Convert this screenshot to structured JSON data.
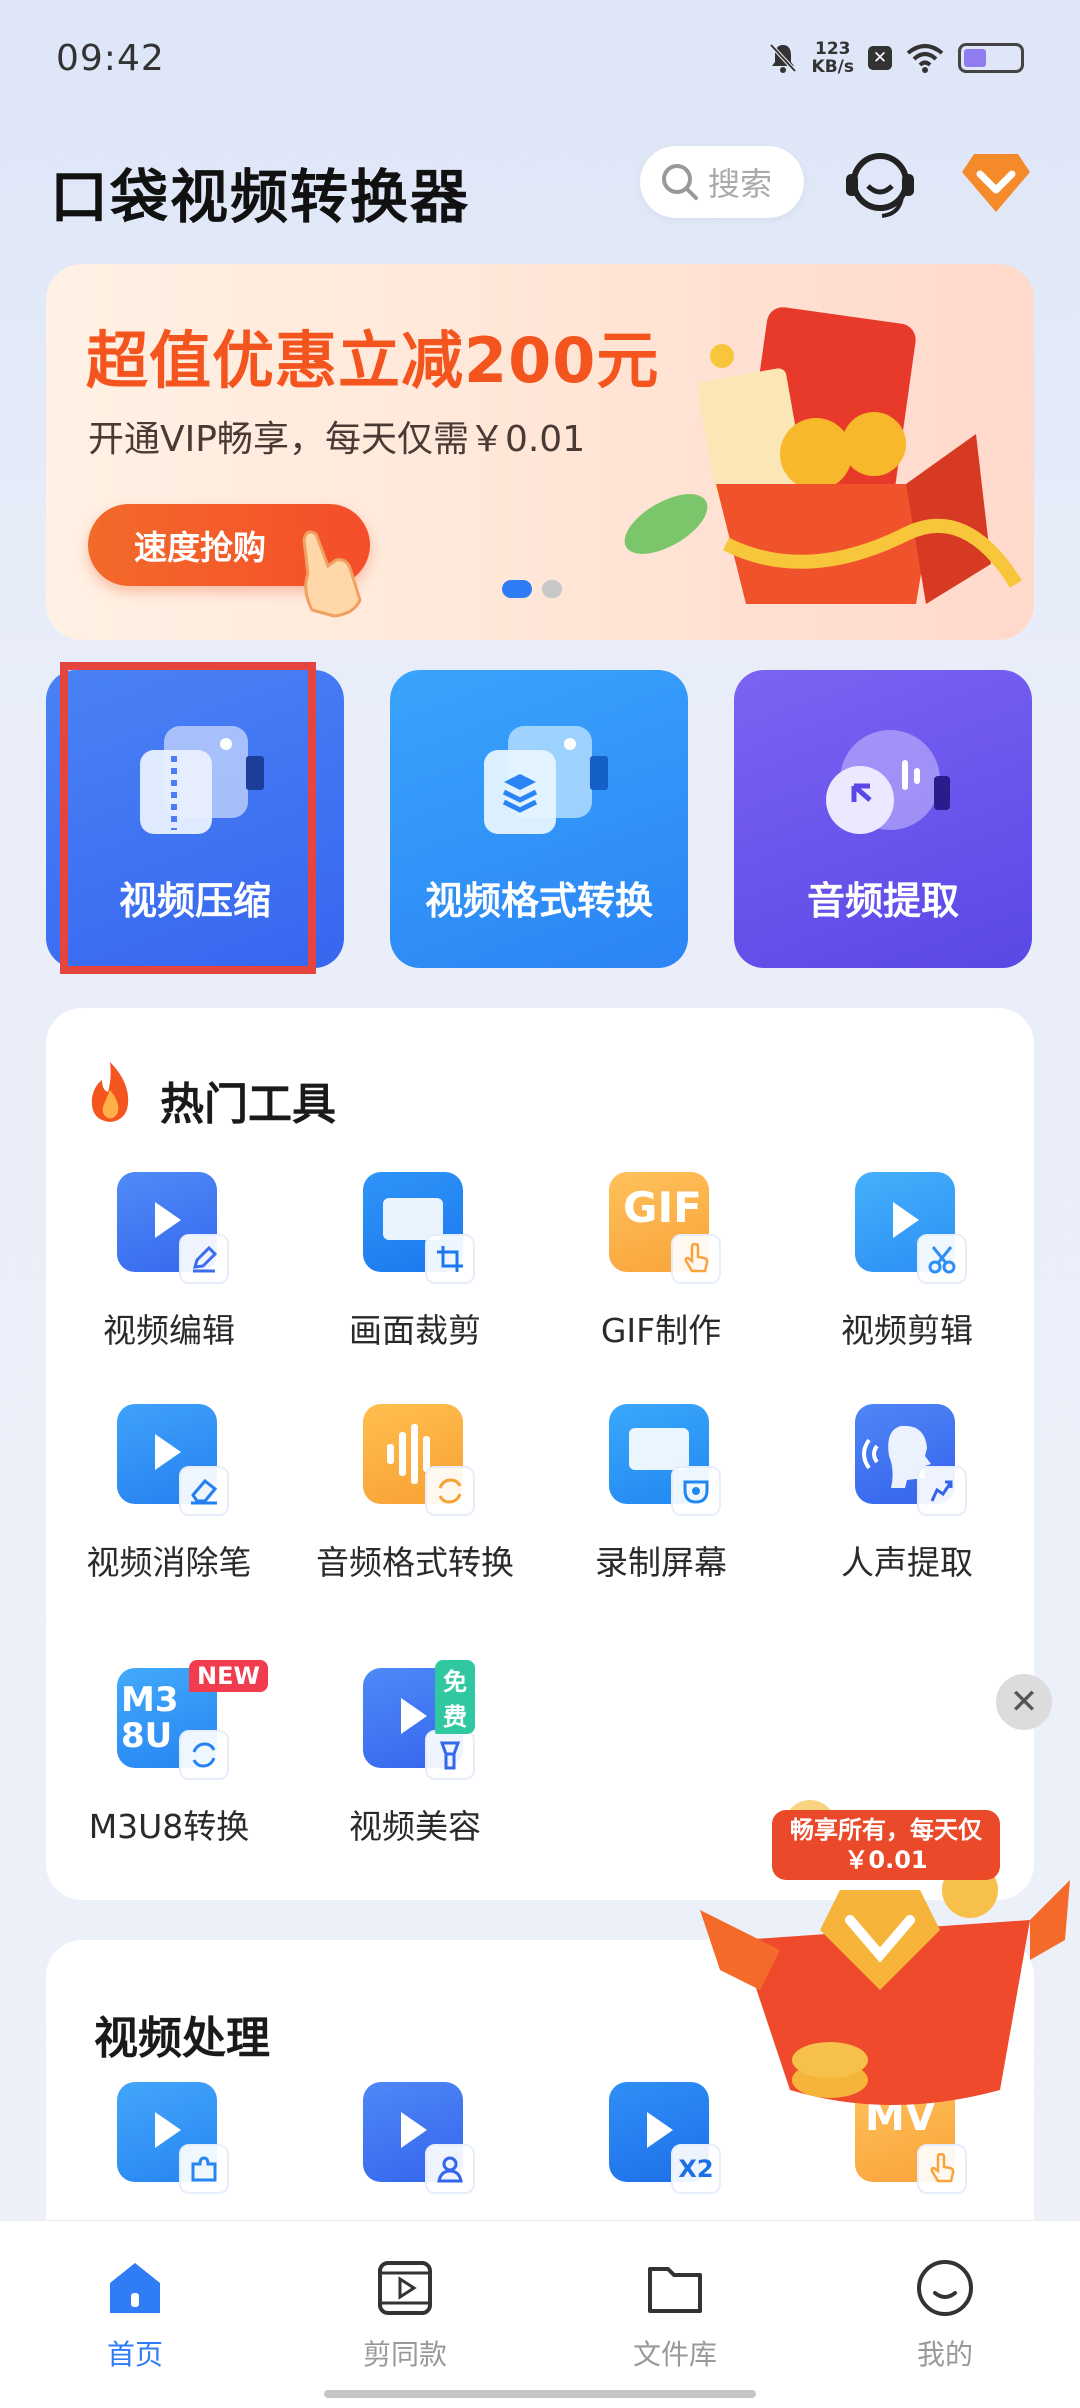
{
  "status_bar": {
    "time": "09:42",
    "net_speed_value": "123",
    "net_speed_unit": "KB/s",
    "battery_level": 0.4
  },
  "header": {
    "title": "口袋视频转换器",
    "search_placeholder": "搜索"
  },
  "banner": {
    "headline": "超值优惠立减200元",
    "subtitle": "开通VIP畅享，每天仅需￥0.01",
    "button": "速度抢购",
    "page_index": 0,
    "page_count": 2
  },
  "features": [
    {
      "label": "视频压缩"
    },
    {
      "label": "视频格式转换"
    },
    {
      "label": "音频提取"
    }
  ],
  "hot_tools": {
    "title": "热门工具",
    "items": [
      {
        "label": "视频编辑"
      },
      {
        "label": "画面裁剪"
      },
      {
        "label": "GIF制作",
        "tile_text": "GIF"
      },
      {
        "label": "视频剪辑"
      },
      {
        "label": "视频消除笔"
      },
      {
        "label": "音频格式转换"
      },
      {
        "label": "录制屏幕"
      },
      {
        "label": "人声提取"
      },
      {
        "label": "M3U8转换",
        "badge": "NEW",
        "tile_text": "M3 8U"
      },
      {
        "label": "视频美容",
        "badge": "免费"
      }
    ]
  },
  "video_processing": {
    "title": "视频处理",
    "tile_texts": [
      "X2",
      "MV"
    ]
  },
  "float_ad": {
    "text_line1": "畅享所有，每天仅",
    "text_line2": "￥0.01"
  },
  "bottom_nav": [
    {
      "label": "首页",
      "active": true
    },
    {
      "label": "剪同款"
    },
    {
      "label": "文件库"
    },
    {
      "label": "我的"
    }
  ],
  "colors": {
    "accent_blue": "#2f7cf6",
    "highlight_red": "#e5443f",
    "banner_orange": "#f4551f"
  }
}
